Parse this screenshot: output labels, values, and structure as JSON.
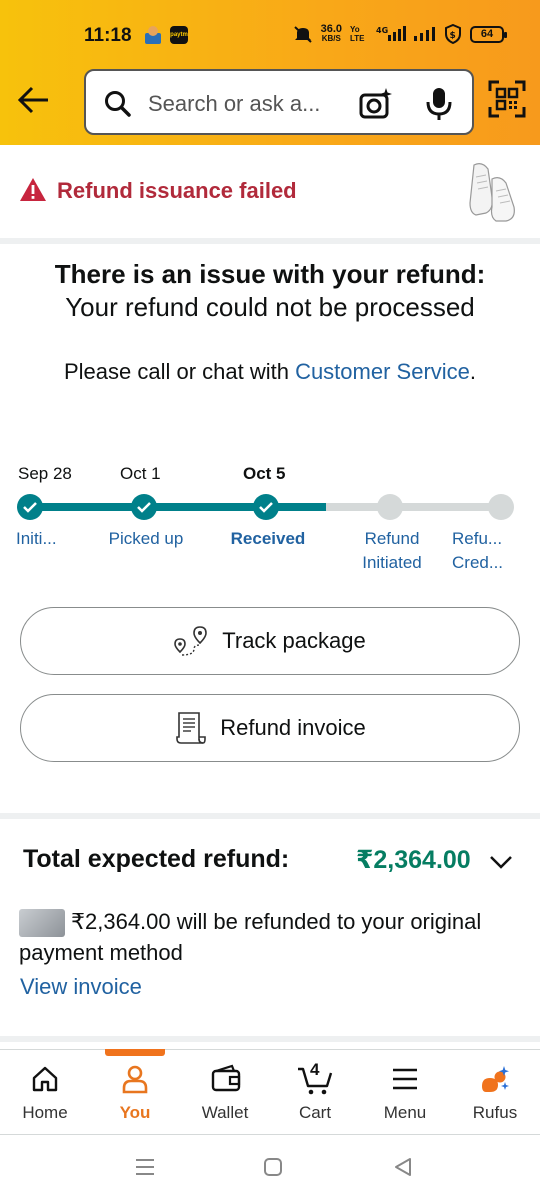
{
  "status_bar": {
    "time": "11:18",
    "net_speed": "36.0",
    "net_unit": "KB/S",
    "volte": "Yo LTE",
    "signal": "4G",
    "battery": "64"
  },
  "search": {
    "placeholder": "Search or ask a..."
  },
  "alert": {
    "text": "Refund issuance failed"
  },
  "issue": {
    "bold": "There is an issue with your refund:",
    "rest": " Your refund could not be processed",
    "help_prefix": "Please call or chat with ",
    "help_link": "Customer Service",
    "help_suffix": "."
  },
  "timeline": {
    "dates": [
      "Sep 28",
      "Oct 1",
      "Oct 5"
    ],
    "steps": [
      "Initi...",
      "Picked up",
      "Received",
      "Refund Initiated",
      "Refu... Cred..."
    ],
    "completed_steps": 3
  },
  "buttons": {
    "track": "Track package",
    "invoice": "Refund invoice"
  },
  "refund": {
    "total_label": "Total expected refund:",
    "total_amount": "₹2,364.00",
    "note": "₹2,364.00 will be refunded to your original payment method",
    "view_invoice": "View invoice"
  },
  "bottom_nav": {
    "items": [
      "Home",
      "You",
      "Wallet",
      "Cart",
      "Menu",
      "Rufus"
    ],
    "active": "You",
    "cart_count": "4"
  },
  "colors": {
    "header_start": "#f7c20c",
    "header_end": "#f79a1c",
    "alert_red": "#b12a3b",
    "teal": "#00808a",
    "link_blue": "#2162a1",
    "refund_green": "#067d62",
    "active_orange": "#e8761f"
  }
}
